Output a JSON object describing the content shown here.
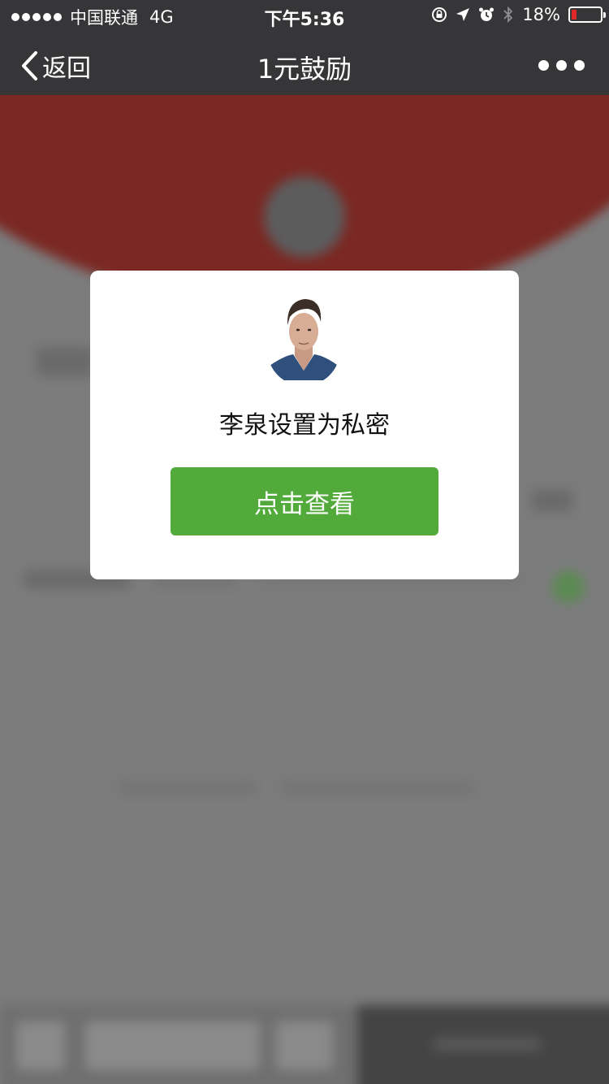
{
  "status_bar": {
    "carrier": "中国联通",
    "network": "4G",
    "time": "下午5:36",
    "battery_percent": "18%",
    "battery_level": 0.18,
    "battery_color": "#e02a2a",
    "icons": [
      "rotation-lock-icon",
      "location-icon",
      "alarm-icon",
      "bluetooth-icon"
    ]
  },
  "nav": {
    "back_label": "返回",
    "title": "1元鼓励"
  },
  "modal": {
    "message": "李泉设置为私密",
    "button_label": "点击查看",
    "button_color": "#52aa3b"
  }
}
